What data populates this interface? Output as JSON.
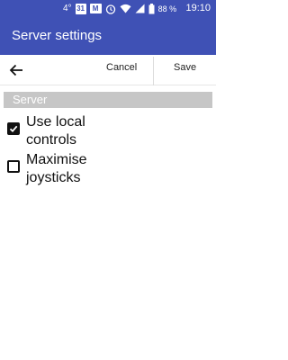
{
  "status_bar": {
    "temperature": "4°",
    "calendar_day": "31",
    "battery": "88 %",
    "time": "19:10"
  },
  "app_bar": {
    "title": "Server settings"
  },
  "toolbar": {
    "cancel_label": "Cancel",
    "save_label": "Save"
  },
  "section": {
    "title": "Server"
  },
  "settings": [
    {
      "label": "Use local controls",
      "checked": true
    },
    {
      "label": "Maximise joysticks",
      "checked": false
    }
  ],
  "colors": {
    "primary": "#3F51B5",
    "section_header": "#C6C6C6"
  }
}
